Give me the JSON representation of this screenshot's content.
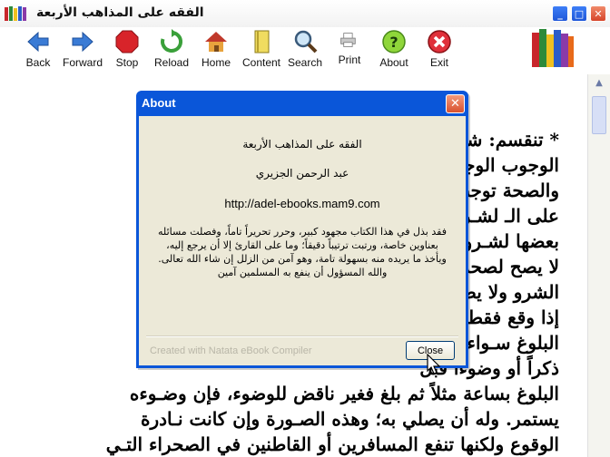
{
  "window": {
    "title": "الفقه على المذاهب الأربعة",
    "controls": [
      "_",
      "□",
      "✕"
    ]
  },
  "toolbar": {
    "buttons": [
      {
        "label": "Back",
        "icon": "back-arrow-icon"
      },
      {
        "label": "Forward",
        "icon": "forward-arrow-icon"
      },
      {
        "label": "Stop",
        "icon": "stop-icon"
      },
      {
        "label": "Reload",
        "icon": "reload-icon"
      },
      {
        "label": "Home",
        "icon": "home-icon"
      },
      {
        "label": "Content",
        "icon": "content-book-icon"
      },
      {
        "label": "Search",
        "icon": "search-icon"
      },
      {
        "label": "Print",
        "icon": "print-icon"
      },
      {
        "label": "About",
        "icon": "help-icon"
      },
      {
        "label": "Exit",
        "icon": "exit-icon"
      }
    ]
  },
  "content": {
    "lines": [
      "* تنقسم: شـروط",
      "الوجوب الوجـوب",
      "والصحة توجب",
      "على الـ لشـروط أو",
      "بعضها لشـروط التي",
      "لا يصح لصحة معاً",
      "الشرو ولا يصح",
      "إذا وقع فقط منها",
      "البلوغ سـواء كـان",
      "ذكراً أو وضوءاً قبل",
      "البلوغ بساعة مثلاً ثم بلغ فغير ناقض للوضوء، فإن وضـوءه",
      "يستمر. وله أن يصلي به؛ وهذه الصـورة وإن كانت نـادرة",
      "الوقوع ولكنها تنفع المسافرين أو القاطنين في الصحراء التـي"
    ]
  },
  "about_dialog": {
    "title": "About",
    "close_glyph": "✕",
    "book_title": "الفقه على المذاهب الأربعة",
    "author": "عبد الرحمن الجزيري",
    "url": "http://adel-ebooks.mam9.com",
    "description": "فقد بذل في هذا الكتاب مجهود كبير، وحرر تحريراً تاماً، وفصلت مسائله بعناوين خاصة، ورتبت ترتيباً دقيقاً؛ وما على القارئ إلا أن يرجع إليه، ويأخذ ما يريده منه بسهولة تامة، وهو آمن من الزلل إن شاء الله تعالى. والله المسؤول أن ينفع به المسلمين آمين",
    "credit": "Created with Natata eBook Compiler",
    "close_button": "Close"
  },
  "colors": {
    "dialog_frame": "#0a56d9",
    "dialog_body": "#ece9d8",
    "link": "#0645ad"
  }
}
